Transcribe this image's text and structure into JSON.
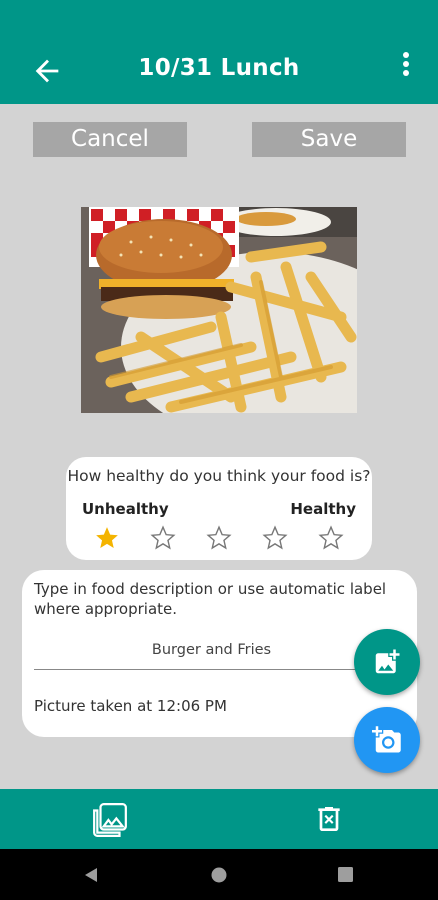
{
  "appbar": {
    "title": "10/31 Lunch",
    "back_icon": "arrow-back-icon",
    "menu_icon": "more-vert-icon"
  },
  "actions": {
    "cancel_label": "Cancel",
    "save_label": "Save"
  },
  "photo": {
    "subject": "burger-and-fries-photo"
  },
  "rating": {
    "question": "How healthy do you think your food is?",
    "low_label": "Unhealthy",
    "high_label": "Healthy",
    "value": 1,
    "max": 5
  },
  "description": {
    "prompt": "Type in food description or use automatic label where appropriate.",
    "value": "Burger and Fries",
    "taken_text": "Picture taken at 12:06 PM"
  },
  "fabs": {
    "gallery_icon": "add-photo-icon",
    "camera_icon": "add-a-photo-icon"
  },
  "bottombar": {
    "gallery_icon": "photo-library-icon",
    "delete_icon": "delete-icon"
  },
  "colors": {
    "primary": "#009688",
    "accent": "#2196f3",
    "star": "#f4b400",
    "background": "#d3d3d3"
  }
}
